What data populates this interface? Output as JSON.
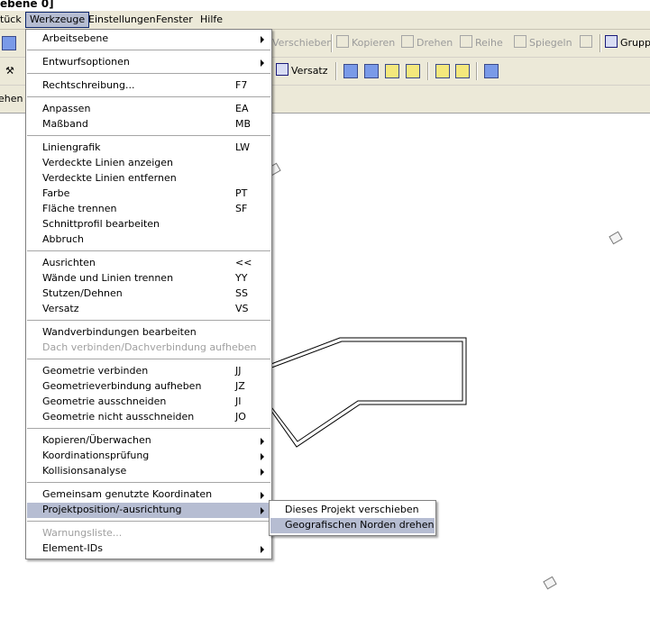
{
  "window": {
    "title_fragment": "ebene 0]"
  },
  "menubar": [
    "tück",
    "Werkzeuge",
    "Einstellungen",
    "Fenster",
    "Hilfe"
  ],
  "toolbar1": {
    "buttons": [
      "Verschieben",
      "Kopieren",
      "Drehen",
      "Reihe",
      "Spiegeln",
      "Grupp"
    ]
  },
  "toolbar2": {
    "versatz": "Versatz"
  },
  "toolbar3": {
    "left_fragment": "ehen"
  },
  "menu": [
    {
      "label": "Arbeitsebene",
      "shortcut": "",
      "submenu": true
    },
    {
      "label": "Entwurfsoptionen",
      "shortcut": "",
      "submenu": true
    },
    {
      "label": "Rechtschreibung...",
      "shortcut": "F7"
    },
    {
      "label": "Anpassen",
      "shortcut": "EA"
    },
    {
      "label": "Maßband",
      "shortcut": "MB"
    },
    {
      "label": "Liniengrafik",
      "shortcut": "LW"
    },
    {
      "label": "Verdeckte Linien anzeigen",
      "shortcut": ""
    },
    {
      "label": "Verdeckte Linien entfernen",
      "shortcut": ""
    },
    {
      "label": "Farbe",
      "shortcut": "PT"
    },
    {
      "label": "Fläche trennen",
      "shortcut": "SF"
    },
    {
      "label": "Schnittprofil bearbeiten",
      "shortcut": ""
    },
    {
      "label": "Abbruch",
      "shortcut": ""
    },
    {
      "label": "Ausrichten",
      "shortcut": "<<"
    },
    {
      "label": "Wände und Linien trennen",
      "shortcut": "YY"
    },
    {
      "label": "Stutzen/Dehnen",
      "shortcut": "SS"
    },
    {
      "label": "Versatz",
      "shortcut": "VS"
    },
    {
      "label": "Wandverbindungen bearbeiten",
      "shortcut": ""
    },
    {
      "label": "Dach verbinden/Dachverbindung aufheben",
      "shortcut": "",
      "disabled": true
    },
    {
      "label": "Geometrie verbinden",
      "shortcut": "JJ"
    },
    {
      "label": "Geometrieverbindung aufheben",
      "shortcut": "JZ"
    },
    {
      "label": "Geometrie ausschneiden",
      "shortcut": "JI"
    },
    {
      "label": "Geometrie nicht ausschneiden",
      "shortcut": "JO"
    },
    {
      "label": "Kopieren/Überwachen",
      "shortcut": "",
      "submenu": true
    },
    {
      "label": "Koordinationsprüfung",
      "shortcut": "",
      "submenu": true
    },
    {
      "label": "Kollisionsanalyse",
      "shortcut": "",
      "submenu": true
    },
    {
      "label": "Gemeinsam genutzte Koordinaten",
      "shortcut": "",
      "submenu": true
    },
    {
      "label": "Projektposition/-ausrichtung",
      "shortcut": "",
      "submenu": true,
      "highlighted": true
    },
    {
      "label": "Warnungsliste...",
      "shortcut": "",
      "disabled": true
    },
    {
      "label": "Element-IDs",
      "shortcut": "",
      "submenu": true
    }
  ],
  "submenu": [
    {
      "label": "Dieses Projekt verschieben"
    },
    {
      "label": "Geografischen Norden drehen",
      "highlighted": true
    }
  ],
  "colors": {
    "highlight": "#b6bdd2",
    "chrome": "#ece9d8",
    "disabled": "#a0a0a0"
  }
}
